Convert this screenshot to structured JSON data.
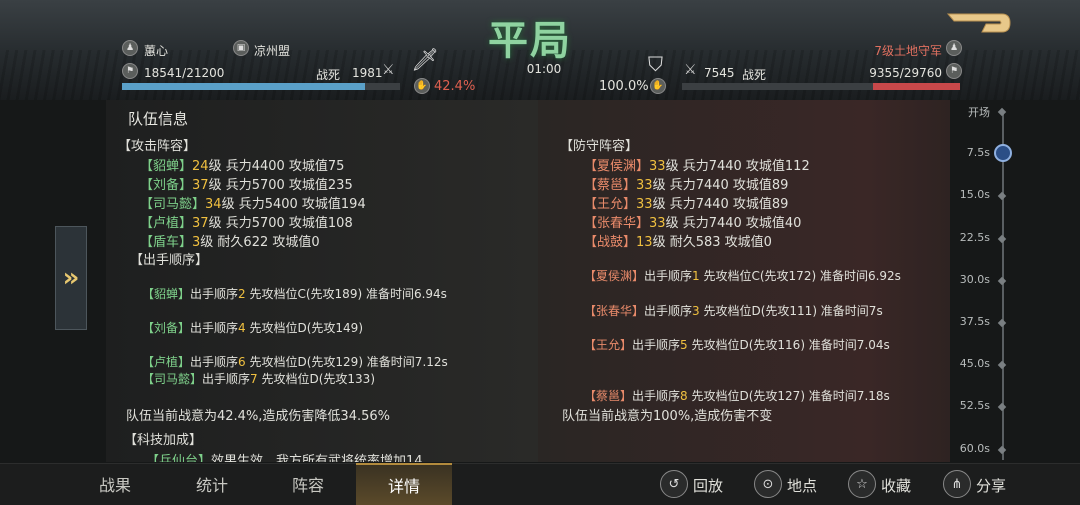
{
  "header": {
    "result": "平局",
    "time": "01:00",
    "left": {
      "name": "蕙心",
      "alliance": "凉州盟",
      "hp": "18541/21200",
      "hp_fraction": 0.875,
      "killed_label": "战死",
      "killed": "1981",
      "morale": "42.4%"
    },
    "right": {
      "name": "7级土地守军",
      "hp": "9355/29760",
      "hp_fraction": 0.314,
      "killed_label": "战死",
      "killed": "7545",
      "morale": "100.0%"
    }
  },
  "left_panel": {
    "title": "队伍信息",
    "attack_header": "【攻击阵容】",
    "attack": [
      {
        "name": "【貂蝉】",
        "level": "24",
        "rest": "级 兵力4400 攻城值75"
      },
      {
        "name": "【刘备】",
        "level": "37",
        "rest": "级 兵力5700 攻城值235"
      },
      {
        "name": "【司马懿】",
        "level": "34",
        "rest": "级 兵力5400 攻城值194"
      },
      {
        "name": "【卢植】",
        "level": "37",
        "rest": "级 兵力5700 攻城值108"
      },
      {
        "name": "【盾车】",
        "level": "3",
        "rest": "级 耐久622 攻城值0"
      }
    ],
    "order_header": "【出手顺序】",
    "order": [
      {
        "name": "【貂蝉】",
        "pre": "出手顺序",
        "num": "2",
        "post": " 先攻档位C(先攻189) 准备时间6.94s"
      },
      {
        "name": "【刘备】",
        "pre": "出手顺序",
        "num": "4",
        "post": " 先攻档位D(先攻149)"
      },
      {
        "name": "【卢植】",
        "pre": "出手顺序",
        "num": "6",
        "post": " 先攻档位D(先攻129) 准备时间7.12s"
      },
      {
        "name": "【司马懿】",
        "pre": "出手顺序",
        "num": "7",
        "post": " 先攻档位D(先攻133)"
      }
    ],
    "morale_text": "队伍当前战意为42.4%,造成伤害降低34.56%",
    "tech_header": "【科技加成】",
    "tech_partial_name": "【兵仙台】",
    "tech_partial_text": "效果生效，我方所有武将统率增加14"
  },
  "right_panel": {
    "defense_header": "【防守阵容】",
    "defense": [
      {
        "name": "【夏侯渊】",
        "level": "33",
        "rest": "级 兵力7440 攻城值112"
      },
      {
        "name": "【蔡邕】",
        "level": "33",
        "rest": "级 兵力7440 攻城值89"
      },
      {
        "name": "【王允】",
        "level": "33",
        "rest": "级 兵力7440 攻城值89"
      },
      {
        "name": "【张春华】",
        "level": "33",
        "rest": "级 兵力7440 攻城值40"
      },
      {
        "name": "【战鼓】",
        "level": "13",
        "rest": "级 耐久583 攻城值0"
      }
    ],
    "order": [
      {
        "name": "【夏侯渊】",
        "pre": "出手顺序",
        "num": "1",
        "post": " 先攻档位C(先攻172) 准备时间6.92s"
      },
      {
        "name": "【张春华】",
        "pre": "出手顺序",
        "num": "3",
        "post": " 先攻档位D(先攻111) 准备时间7s"
      },
      {
        "name": "【王允】",
        "pre": "出手顺序",
        "num": "5",
        "post": " 先攻档位D(先攻116) 准备时间7.04s"
      },
      {
        "name": "【蔡邕】",
        "pre": "出手顺序",
        "num": "8",
        "post": " 先攻档位D(先攻127) 准备时间7.18s"
      }
    ],
    "morale_text": "队伍当前战意为100%,造成伤害不变"
  },
  "timeline": [
    "开场",
    "7.5s",
    "15.0s",
    "22.5s",
    "30.0s",
    "37.5s",
    "45.0s",
    "52.5s",
    "60.0s"
  ],
  "tabs": [
    "战果",
    "统计",
    "阵容",
    "详情"
  ],
  "actions": {
    "replay": "回放",
    "location": "地点",
    "favorite": "收藏",
    "share": "分享"
  },
  "colors": {
    "hp_left": "#5aa0c8",
    "hp_right": "#c8484a",
    "accent": "#b38b3d"
  }
}
